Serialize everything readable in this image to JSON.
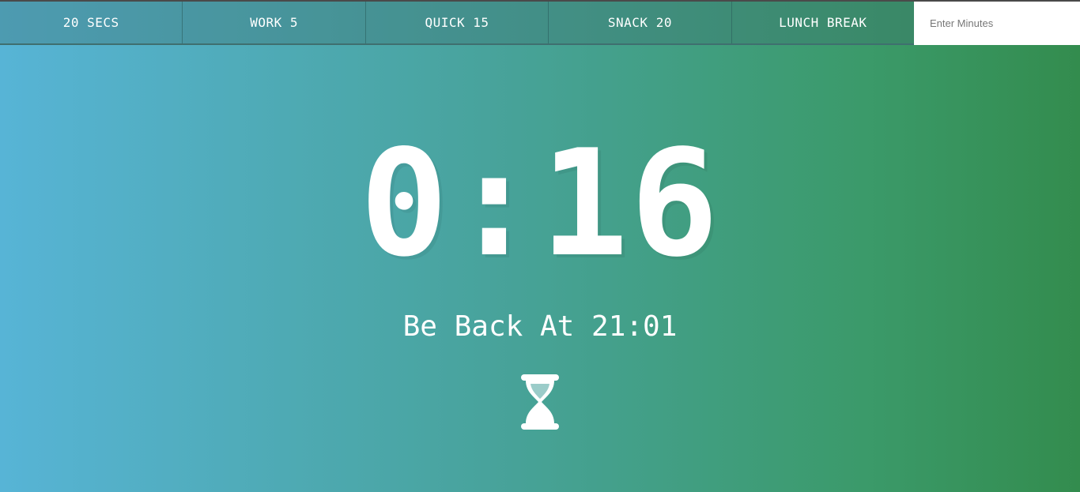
{
  "timer_buttons": [
    {
      "label": "20 SECS"
    },
    {
      "label": "WORK 5"
    },
    {
      "label": "QUICK 15"
    },
    {
      "label": "SNACK 20"
    },
    {
      "label": "LUNCH BREAK"
    }
  ],
  "custom_input": {
    "placeholder": "Enter Minutes",
    "value": ""
  },
  "display": {
    "time_left": "0:16",
    "end_time": "Be Back At 21:01"
  },
  "icons": {
    "status": "hourglass-icon"
  },
  "colors": {
    "gradient_start": "#57b4d6",
    "gradient_end": "#338c4e",
    "text": "#ffffff"
  }
}
